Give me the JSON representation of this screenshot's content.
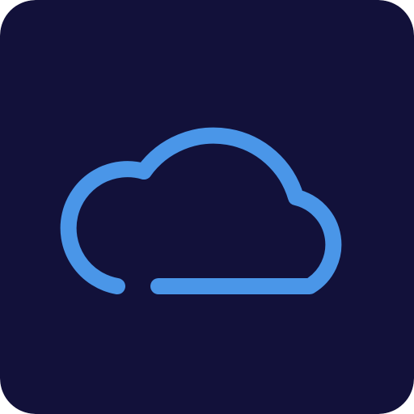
{
  "icon": {
    "name": "cloud-icon",
    "colors": {
      "background": "#12113a",
      "stroke": "#4a96e8"
    }
  }
}
